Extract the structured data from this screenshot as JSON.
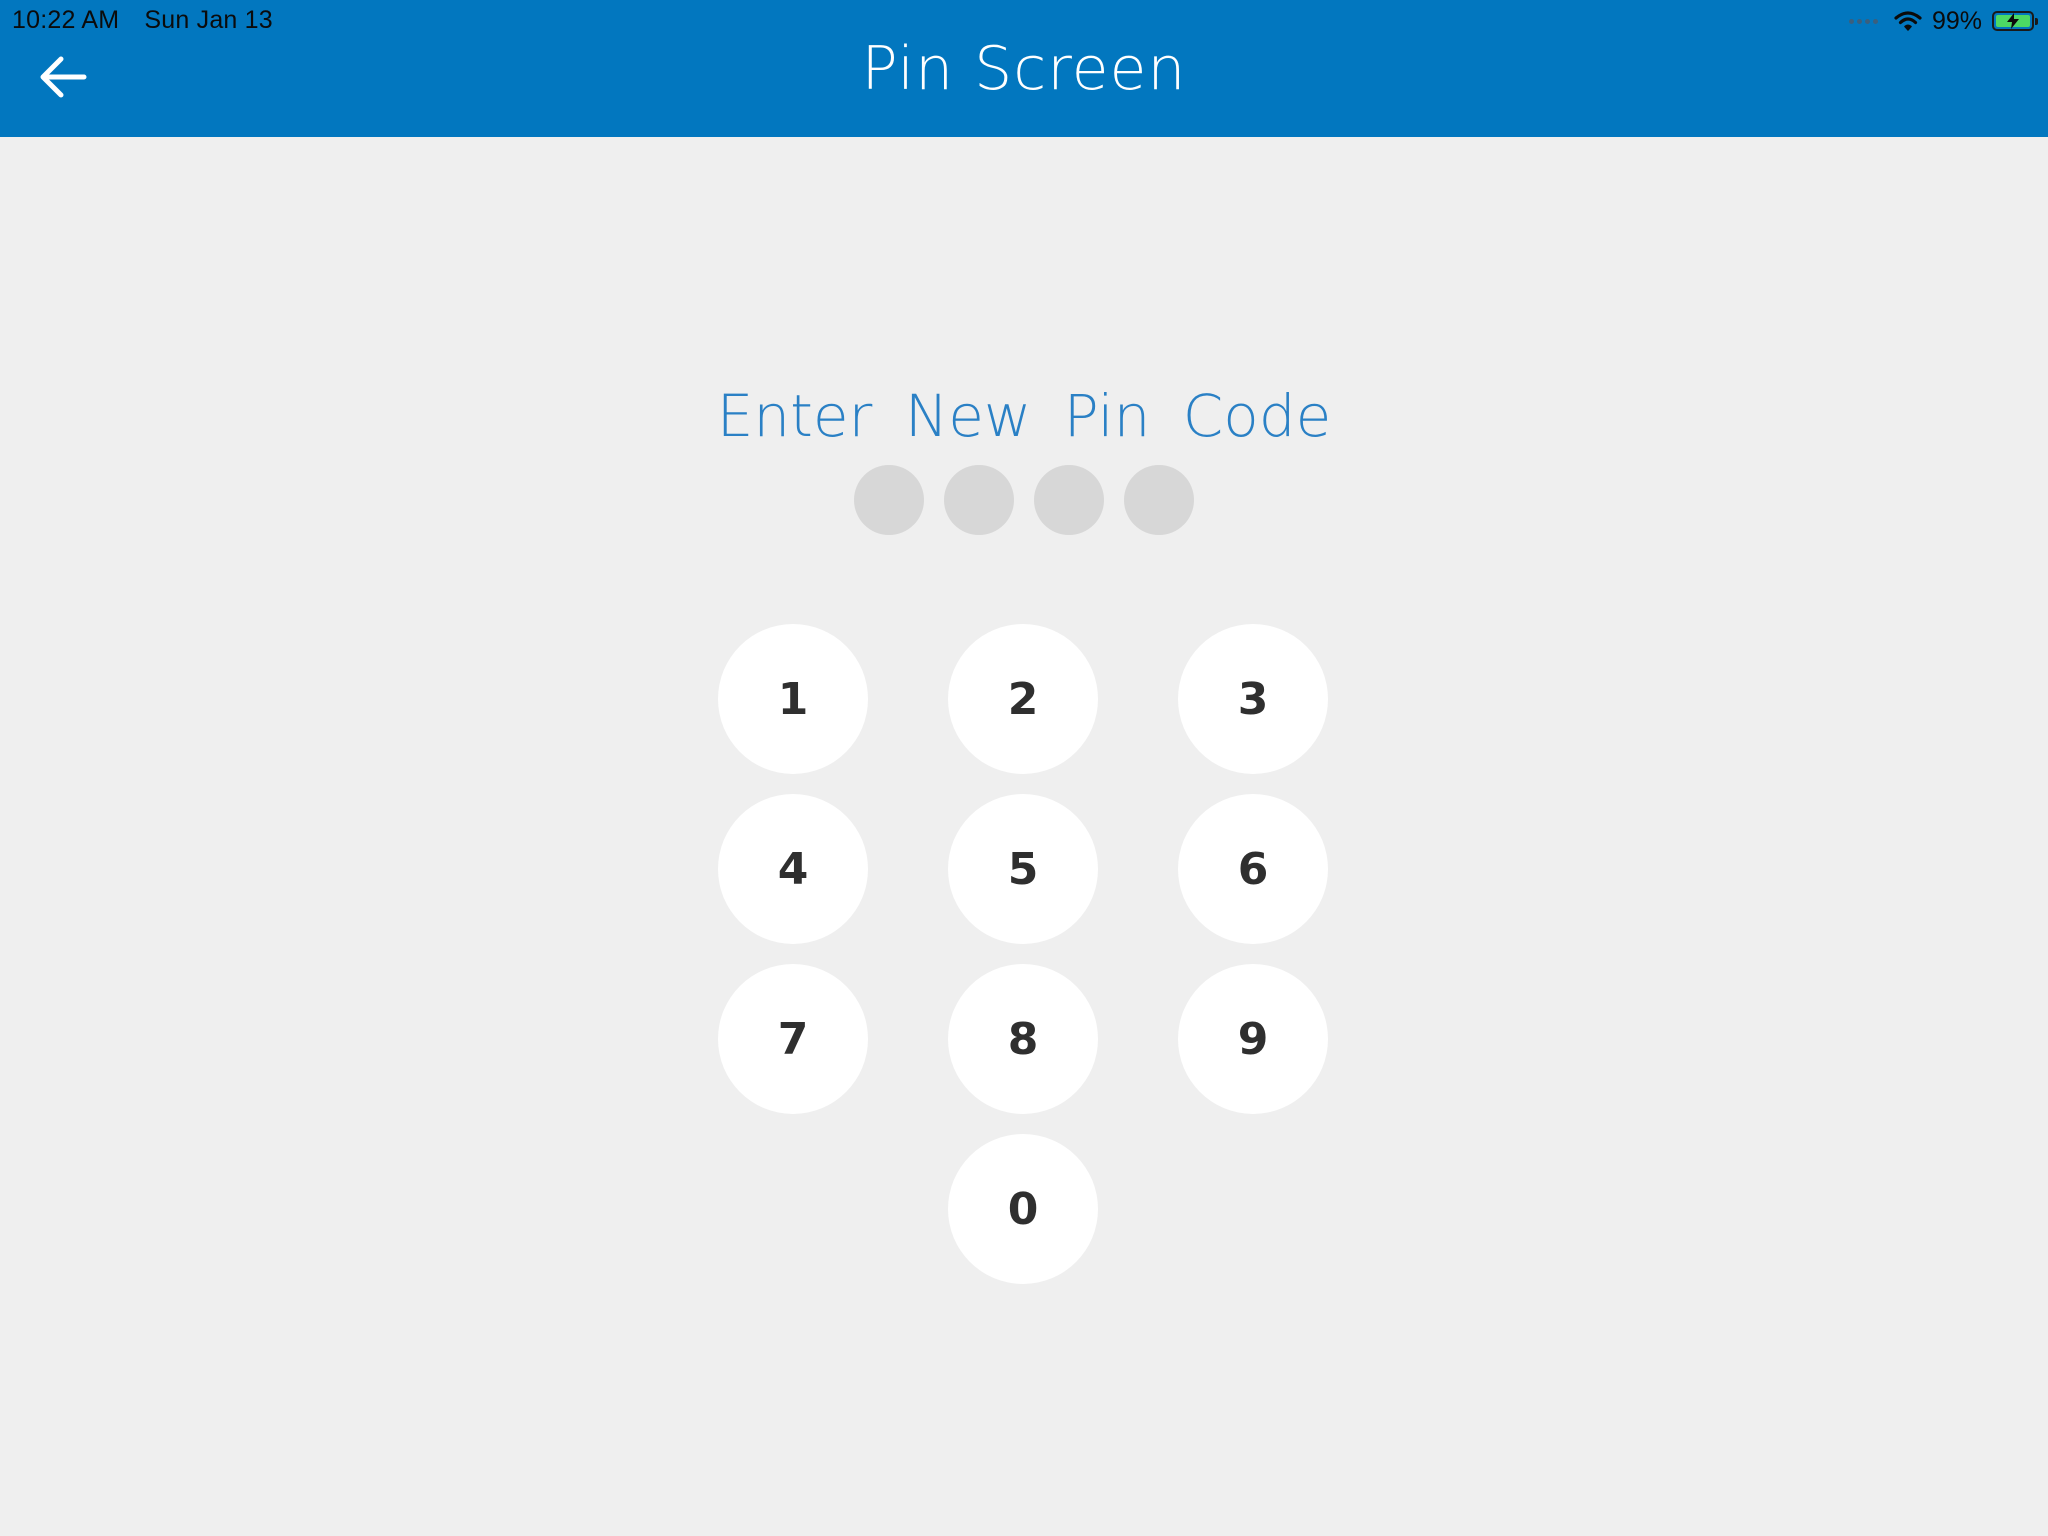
{
  "status_bar": {
    "time": "10:22 AM",
    "date": "Sun Jan 13",
    "battery_percent": "99%",
    "battery_level": 0.99,
    "charging": true,
    "icons": [
      "cellular-signal-icon",
      "wifi-icon",
      "battery-charging-icon"
    ]
  },
  "header": {
    "title": "Pin Screen",
    "back_icon": "arrow-left-icon",
    "background_color": "#0277bf"
  },
  "pin": {
    "prompt": "Enter  New  Pin Code",
    "prompt_color": "#2a80c5",
    "length": 4,
    "entered": 0
  },
  "keypad": {
    "keys": [
      "1",
      "2",
      "3",
      "4",
      "5",
      "6",
      "7",
      "8",
      "9",
      "0"
    ]
  }
}
